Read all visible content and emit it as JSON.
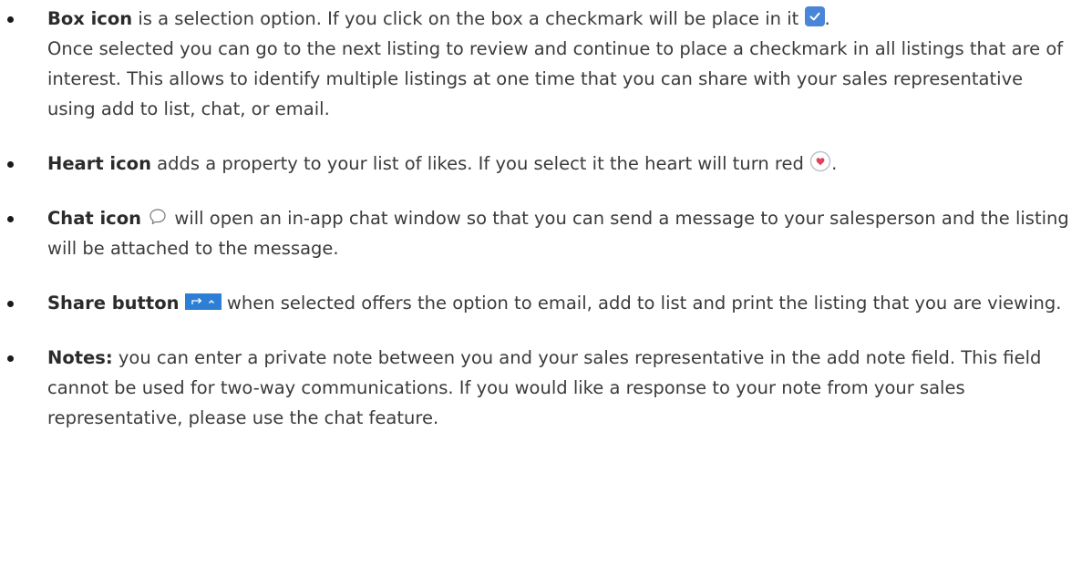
{
  "items": [
    {
      "title": "Box icon",
      "text_a": " is a selection option.  If you click on the box a checkmark will be place in it ",
      "text_b": ".",
      "text_c": "Once selected you can go to the next listing to review and continue to place a checkmark in all listings that are of interest. This allows to identify multiple listings at one time that you can share with your sales representative using add to list, chat, or email.",
      "icon": "checked-checkbox-icon"
    },
    {
      "title": "Heart icon",
      "text_a": " adds a property to your list of likes. If you select it the heart will turn red ",
      "text_b": ".",
      "icon": "heart-icon"
    },
    {
      "title": "Chat icon",
      "text_a": " will open an in-app chat window so that you can send a message to your salesperson and the listing will be attached to the message.",
      "icon": "chat-bubble-icon"
    },
    {
      "title": "Share button",
      "text_a": " when selected offers the option to email, add to list and print the listing that you are viewing.",
      "icon": "share-button-icon"
    },
    {
      "title": "Notes:",
      "text_a": " you can enter a private note between you and your sales representative in the add note field.  This field cannot be used for two-way communications.  If you would like a response to your note from your sales representative, please use the chat feature."
    }
  ],
  "colors": {
    "text": "#3b3b3b",
    "checkbox_blue": "#4a86d8",
    "share_blue": "#2d7fd6",
    "heart_red": "#e0435b"
  }
}
